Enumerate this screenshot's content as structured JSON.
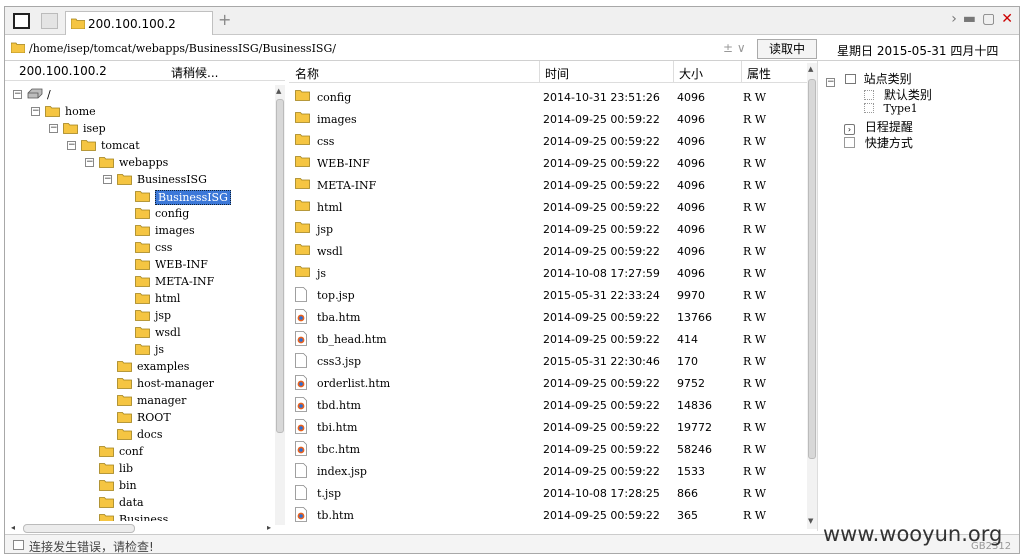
{
  "tab": {
    "title": "200.100.100.2",
    "new_tab": "+"
  },
  "window_controls": {
    "next": "›",
    "minimize": "▬",
    "maximize": "▢",
    "close": "✕"
  },
  "address": {
    "path": "/home/isep/tomcat/webapps/BusinessISG/BusinessISG/",
    "controls": "± ∨",
    "read_button": "读取中",
    "date": "星期日 2015-05-31 四月十四"
  },
  "left": {
    "host": "200.100.100.2",
    "status": "请稍候..."
  },
  "tree": [
    {
      "label": "/",
      "exp": "⊟",
      "depth": 0,
      "icon": "drive"
    },
    {
      "label": "home",
      "exp": "⊟",
      "depth": 1,
      "icon": "folder"
    },
    {
      "label": "isep",
      "exp": "⊟",
      "depth": 2,
      "icon": "folder"
    },
    {
      "label": "tomcat",
      "exp": "⊟",
      "depth": 3,
      "icon": "folder"
    },
    {
      "label": "webapps",
      "exp": "⊟",
      "depth": 4,
      "icon": "folder"
    },
    {
      "label": "BusinessISG",
      "exp": "⊟",
      "depth": 5,
      "icon": "folder"
    },
    {
      "label": "BusinessISG",
      "exp": "",
      "depth": 6,
      "icon": "folder",
      "selected": true
    },
    {
      "label": "config",
      "exp": "",
      "depth": 6,
      "icon": "folder"
    },
    {
      "label": "images",
      "exp": "",
      "depth": 6,
      "icon": "folder"
    },
    {
      "label": "css",
      "exp": "",
      "depth": 6,
      "icon": "folder"
    },
    {
      "label": "WEB-INF",
      "exp": "",
      "depth": 6,
      "icon": "folder"
    },
    {
      "label": "META-INF",
      "exp": "",
      "depth": 6,
      "icon": "folder"
    },
    {
      "label": "html",
      "exp": "",
      "depth": 6,
      "icon": "folder"
    },
    {
      "label": "jsp",
      "exp": "",
      "depth": 6,
      "icon": "folder"
    },
    {
      "label": "wsdl",
      "exp": "",
      "depth": 6,
      "icon": "folder"
    },
    {
      "label": "js",
      "exp": "",
      "depth": 6,
      "icon": "folder"
    },
    {
      "label": "examples",
      "exp": "",
      "depth": 5,
      "icon": "folder"
    },
    {
      "label": "host-manager",
      "exp": "",
      "depth": 5,
      "icon": "folder"
    },
    {
      "label": "manager",
      "exp": "",
      "depth": 5,
      "icon": "folder"
    },
    {
      "label": "ROOT",
      "exp": "",
      "depth": 5,
      "icon": "folder"
    },
    {
      "label": "docs",
      "exp": "",
      "depth": 5,
      "icon": "folder"
    },
    {
      "label": "conf",
      "exp": "",
      "depth": 4,
      "icon": "folder"
    },
    {
      "label": "lib",
      "exp": "",
      "depth": 4,
      "icon": "folder"
    },
    {
      "label": "bin",
      "exp": "",
      "depth": 4,
      "icon": "folder"
    },
    {
      "label": "data",
      "exp": "",
      "depth": 4,
      "icon": "folder"
    },
    {
      "label": "Business",
      "exp": "",
      "depth": 4,
      "icon": "folder"
    }
  ],
  "columns": {
    "name": "名称",
    "time": "时间",
    "size": "大小",
    "attr": "属性"
  },
  "files": [
    {
      "name": "config",
      "time": "2014-10-31 23:51:26",
      "size": "4096",
      "attr": "R W",
      "icon": "folder"
    },
    {
      "name": "images",
      "time": "2014-09-25 00:59:22",
      "size": "4096",
      "attr": "R W",
      "icon": "folder"
    },
    {
      "name": "css",
      "time": "2014-09-25 00:59:22",
      "size": "4096",
      "attr": "R W",
      "icon": "folder"
    },
    {
      "name": "WEB-INF",
      "time": "2014-09-25 00:59:22",
      "size": "4096",
      "attr": "R W",
      "icon": "folder"
    },
    {
      "name": "META-INF",
      "time": "2014-09-25 00:59:22",
      "size": "4096",
      "attr": "R W",
      "icon": "folder"
    },
    {
      "name": "html",
      "time": "2014-09-25 00:59:22",
      "size": "4096",
      "attr": "R W",
      "icon": "folder"
    },
    {
      "name": "jsp",
      "time": "2014-09-25 00:59:22",
      "size": "4096",
      "attr": "R W",
      "icon": "folder"
    },
    {
      "name": "wsdl",
      "time": "2014-09-25 00:59:22",
      "size": "4096",
      "attr": "R W",
      "icon": "folder"
    },
    {
      "name": "js",
      "time": "2014-10-08 17:27:59",
      "size": "4096",
      "attr": "R W",
      "icon": "folder"
    },
    {
      "name": "top.jsp",
      "time": "2015-05-31 22:33:24",
      "size": "9970",
      "attr": "R W",
      "icon": "file"
    },
    {
      "name": "tba.htm",
      "time": "2014-09-25 00:59:22",
      "size": "13766",
      "attr": "R W",
      "icon": "html"
    },
    {
      "name": "tb_head.htm",
      "time": "2014-09-25 00:59:22",
      "size": "414",
      "attr": "R W",
      "icon": "html"
    },
    {
      "name": "css3.jsp",
      "time": "2015-05-31 22:30:46",
      "size": "170",
      "attr": "R W",
      "icon": "file"
    },
    {
      "name": "orderlist.htm",
      "time": "2014-09-25 00:59:22",
      "size": "9752",
      "attr": "R W",
      "icon": "html"
    },
    {
      "name": "tbd.htm",
      "time": "2014-09-25 00:59:22",
      "size": "14836",
      "attr": "R W",
      "icon": "html"
    },
    {
      "name": "tbi.htm",
      "time": "2014-09-25 00:59:22",
      "size": "19772",
      "attr": "R W",
      "icon": "html"
    },
    {
      "name": "tbc.htm",
      "time": "2014-09-25 00:59:22",
      "size": "58246",
      "attr": "R W",
      "icon": "html"
    },
    {
      "name": "index.jsp",
      "time": "2014-09-25 00:59:22",
      "size": "1533",
      "attr": "R W",
      "icon": "file"
    },
    {
      "name": "t.jsp",
      "time": "2014-10-08 17:28:25",
      "size": "866",
      "attr": "R W",
      "icon": "file"
    },
    {
      "name": "tb.htm",
      "time": "2014-09-25 00:59:22",
      "size": "365",
      "attr": "R W",
      "icon": "html"
    }
  ],
  "right_panel": {
    "categories": "站点类别",
    "default_category": "默认类别",
    "type1": "Type1",
    "reminder": "日程提醒",
    "shortcuts": "快捷方式"
  },
  "status_text": "连接发生错误，请检查!",
  "watermark": "www.wooyun.org",
  "encoding": "GB2312",
  "colors": {
    "folder": "#f5c542",
    "selection": "#3c78d8",
    "close": "#cc0000"
  }
}
